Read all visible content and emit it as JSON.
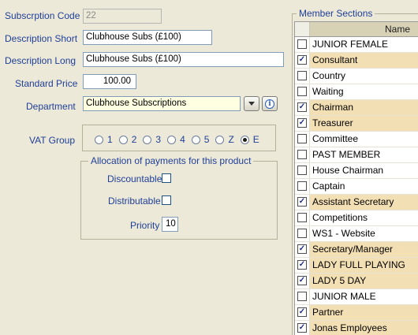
{
  "form": {
    "subscription_code": {
      "label": "Subscrption Code",
      "value": "22"
    },
    "description_short": {
      "label": "Description Short",
      "value": "Clubhouse Subs (£100)"
    },
    "description_long": {
      "label": "Description Long",
      "value": "Clubhouse Subs (£100)"
    },
    "standard_price": {
      "label": "Standard Price",
      "value": "100.00"
    },
    "department": {
      "label": "Department",
      "value": "Clubhouse Subscriptions"
    },
    "vat_group": {
      "label": "VAT Group",
      "options": [
        "1",
        "2",
        "3",
        "4",
        "5",
        "Z",
        "E"
      ],
      "selected": "E"
    },
    "allocation": {
      "title": "Allocation of payments for this product",
      "discountable_label": "Discountable",
      "discountable_checked": false,
      "distributable_label": "Distributable",
      "distributable_checked": false,
      "priority_label": "Priority",
      "priority_value": "10"
    }
  },
  "member_sections": {
    "title": "Member Sections",
    "column_header": "Name",
    "rows": [
      {
        "name": "JUNIOR FEMALE",
        "checked": false
      },
      {
        "name": "Consultant",
        "checked": true
      },
      {
        "name": "Country",
        "checked": false
      },
      {
        "name": "Waiting",
        "checked": false
      },
      {
        "name": "Chairman",
        "checked": true
      },
      {
        "name": "Treasurer",
        "checked": true
      },
      {
        "name": "Committee",
        "checked": false
      },
      {
        "name": "PAST MEMBER",
        "checked": false
      },
      {
        "name": "House Chairman",
        "checked": false
      },
      {
        "name": "Captain",
        "checked": false
      },
      {
        "name": "Assistant Secretary",
        "checked": true
      },
      {
        "name": "Competitions",
        "checked": false
      },
      {
        "name": "WS1 - Website",
        "checked": false
      },
      {
        "name": "Secretary/Manager",
        "checked": true
      },
      {
        "name": "LADY FULL PLAYING",
        "checked": true
      },
      {
        "name": "LADY 5 DAY",
        "checked": true
      },
      {
        "name": "JUNIOR MALE",
        "checked": false
      },
      {
        "name": "Partner",
        "checked": true
      },
      {
        "name": "Jonas Employees",
        "checked": true
      }
    ]
  }
}
